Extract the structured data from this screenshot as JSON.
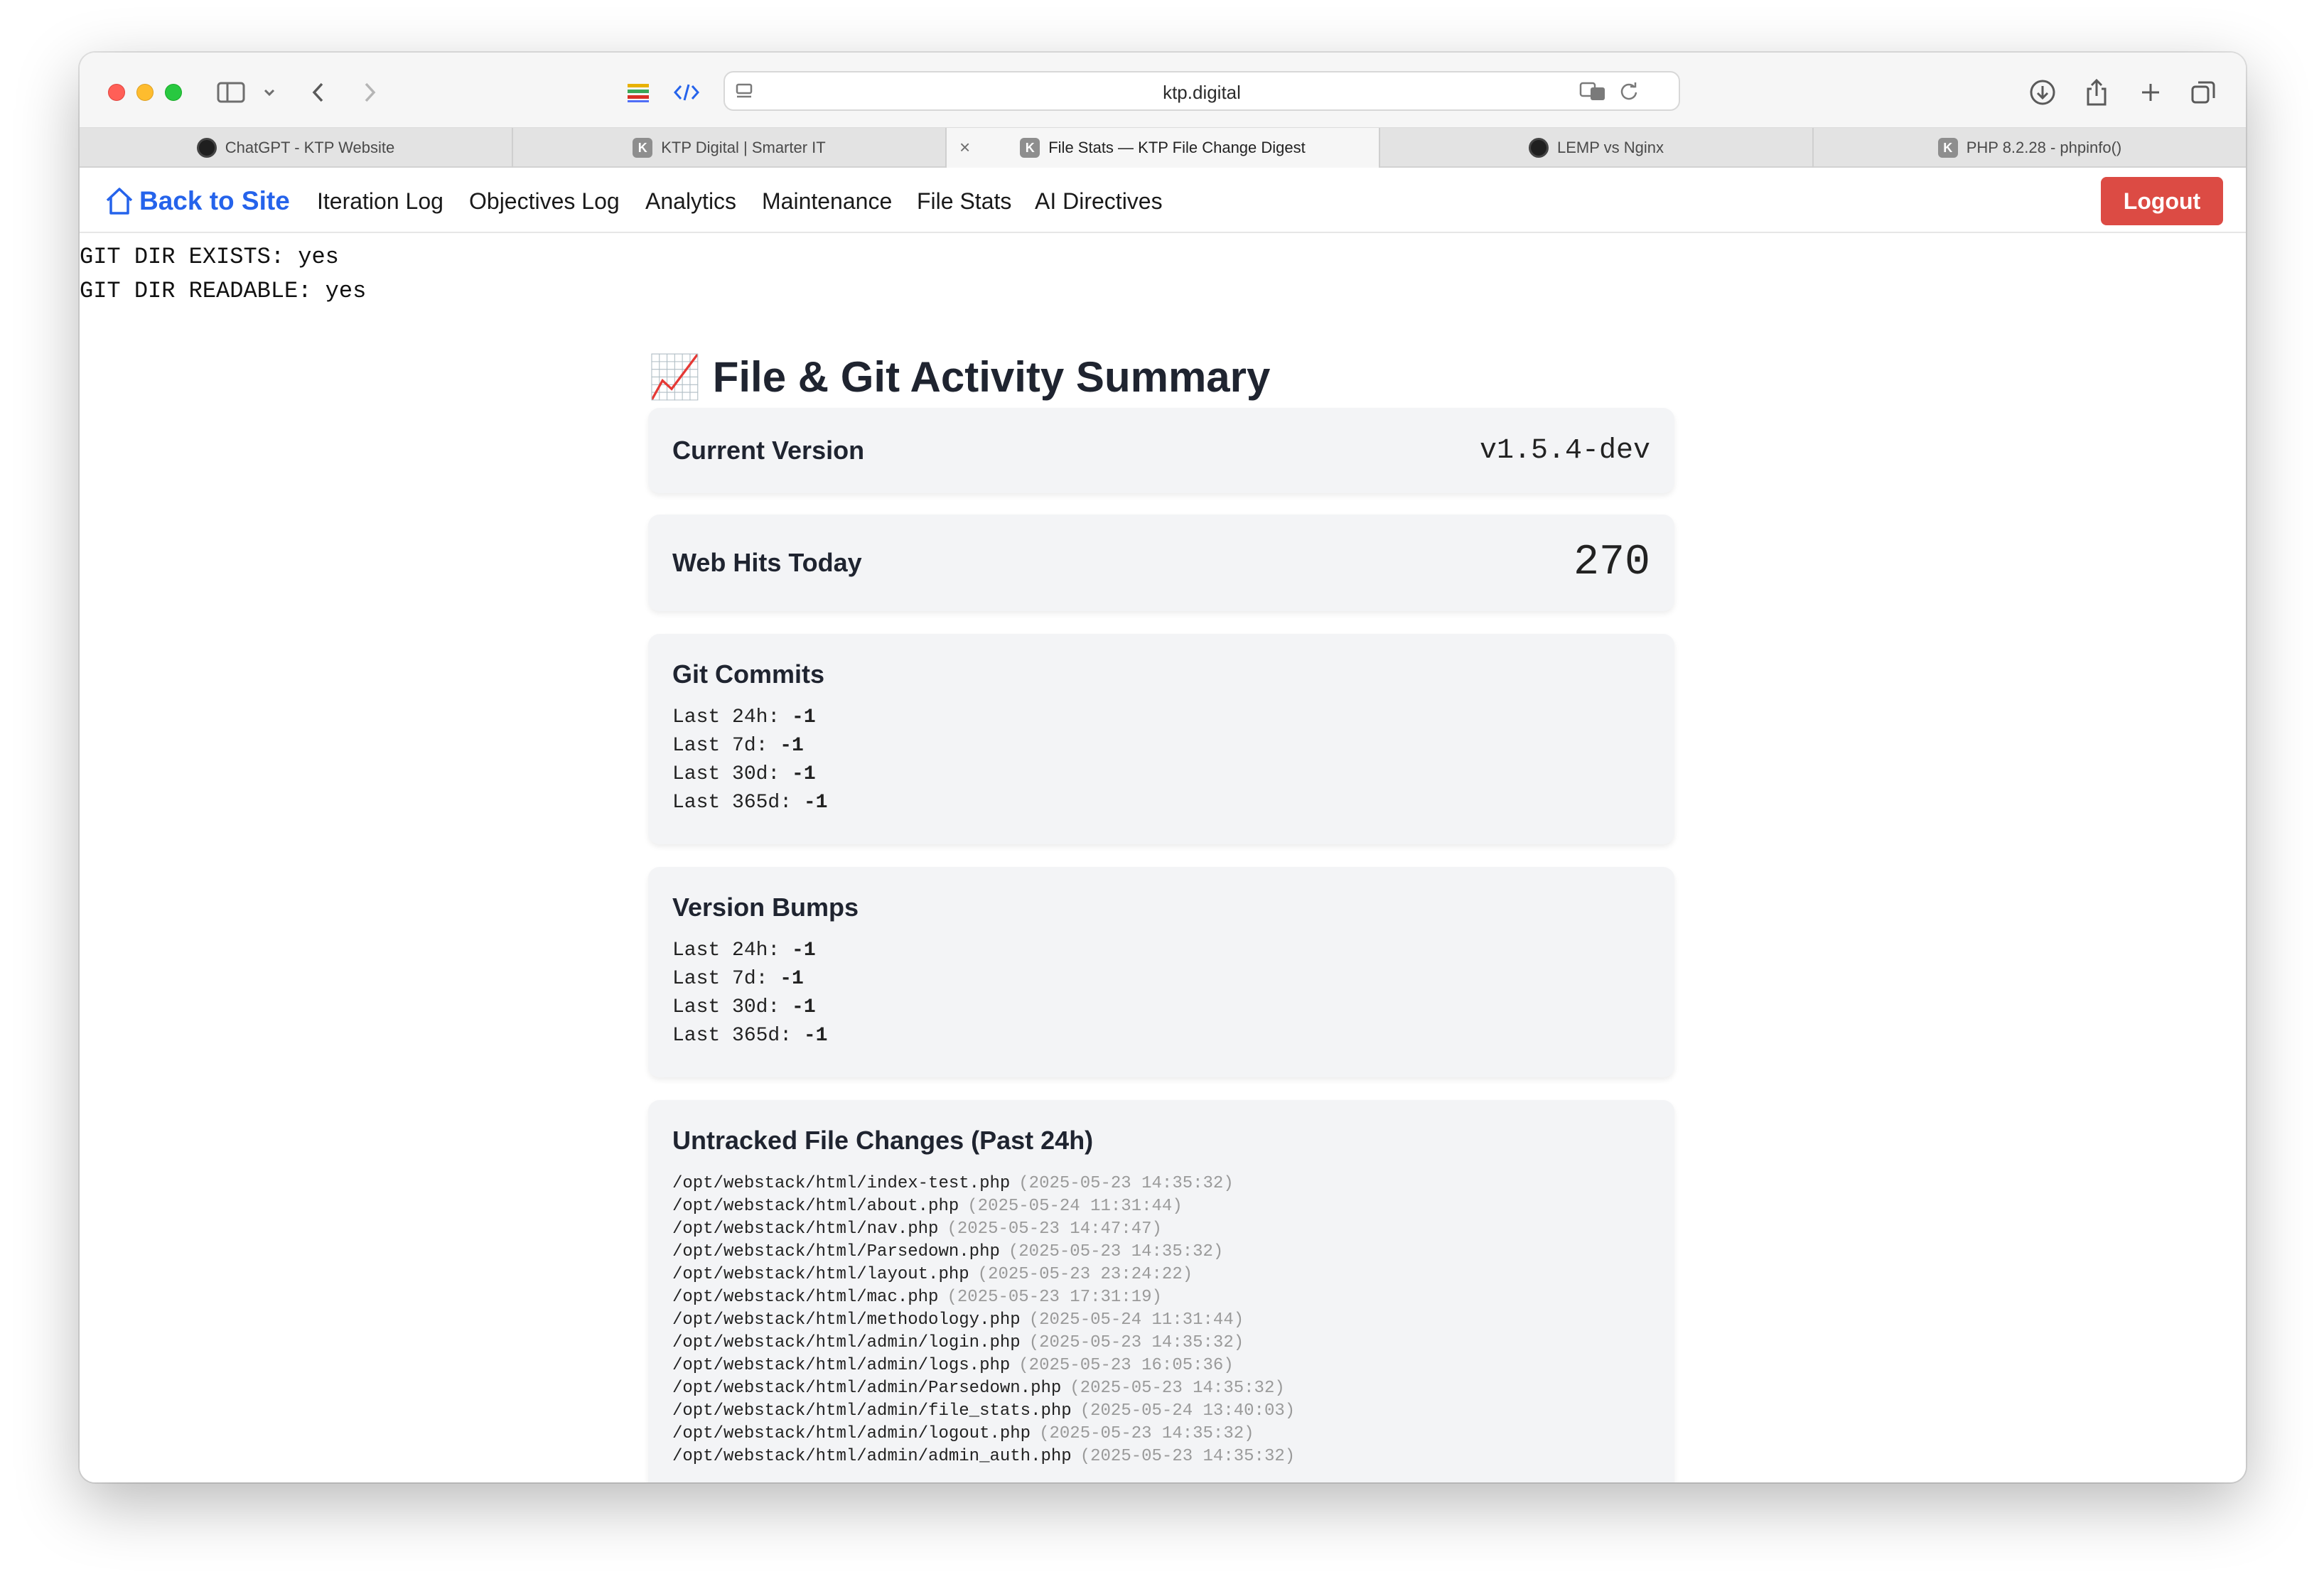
{
  "browser": {
    "address": "ktp.digital",
    "tabs": [
      {
        "title": "ChatGPT - KTP Website",
        "favicon": "openai-icon",
        "active": false
      },
      {
        "title": "KTP Digital | Smarter IT",
        "favicon": "K",
        "active": false
      },
      {
        "title": "File Stats — KTP File Change Digest",
        "favicon": "K",
        "active": true
      },
      {
        "title": "LEMP vs Nginx",
        "favicon": "openai-icon",
        "active": false
      },
      {
        "title": "PHP 8.2.28 - phpinfo()",
        "favicon": "K",
        "active": false
      }
    ],
    "close_glyph": "×"
  },
  "nav": {
    "back_label": "Back to Site",
    "links": [
      "Iteration Log",
      "Objectives Log",
      "Analytics",
      "Maintenance",
      "File Stats",
      "AI Directives"
    ],
    "logout_label": "Logout"
  },
  "debug": [
    "GIT DIR EXISTS: yes",
    "GIT DIR READABLE: yes"
  ],
  "main": {
    "heading_emoji": "📈",
    "heading": "File & Git Activity Summary",
    "version": {
      "label": "Current Version",
      "value": "v1.5.4-dev"
    },
    "hits": {
      "label": "Web Hits Today",
      "value": "270"
    },
    "git_commits": {
      "title": "Git Commits",
      "rows": [
        {
          "label": "Last 24h:",
          "value": "-1"
        },
        {
          "label": "Last 7d:",
          "value": "-1"
        },
        {
          "label": "Last 30d:",
          "value": "-1"
        },
        {
          "label": "Last 365d:",
          "value": "-1"
        }
      ]
    },
    "version_bumps": {
      "title": "Version Bumps",
      "rows": [
        {
          "label": "Last 24h:",
          "value": "-1"
        },
        {
          "label": "Last 7d:",
          "value": "-1"
        },
        {
          "label": "Last 30d:",
          "value": "-1"
        },
        {
          "label": "Last 365d:",
          "value": "-1"
        }
      ]
    },
    "untracked": {
      "title": "Untracked File Changes (Past 24h)",
      "files": [
        {
          "path": "/opt/webstack/html/index-test.php",
          "time": "(2025-05-23 14:35:32)"
        },
        {
          "path": "/opt/webstack/html/about.php",
          "time": "(2025-05-24 11:31:44)"
        },
        {
          "path": "/opt/webstack/html/nav.php",
          "time": "(2025-05-23 14:47:47)"
        },
        {
          "path": "/opt/webstack/html/Parsedown.php",
          "time": "(2025-05-23 14:35:32)"
        },
        {
          "path": "/opt/webstack/html/layout.php",
          "time": "(2025-05-23 23:24:22)"
        },
        {
          "path": "/opt/webstack/html/mac.php",
          "time": "(2025-05-23 17:31:19)"
        },
        {
          "path": "/opt/webstack/html/methodology.php",
          "time": "(2025-05-24 11:31:44)"
        },
        {
          "path": "/opt/webstack/html/admin/login.php",
          "time": "(2025-05-23 14:35:32)"
        },
        {
          "path": "/opt/webstack/html/admin/logs.php",
          "time": "(2025-05-23 16:05:36)"
        },
        {
          "path": "/opt/webstack/html/admin/Parsedown.php",
          "time": "(2025-05-23 14:35:32)"
        },
        {
          "path": "/opt/webstack/html/admin/file_stats.php",
          "time": "(2025-05-24 13:40:03)"
        },
        {
          "path": "/opt/webstack/html/admin/logout.php",
          "time": "(2025-05-23 14:35:32)"
        },
        {
          "path": "/opt/webstack/html/admin/admin_auth.php",
          "time": "(2025-05-23 14:35:32)"
        }
      ]
    }
  },
  "colors": {
    "accent": "#2563eb",
    "logout": "#dc4b44",
    "card_bg": "#f3f4f6"
  }
}
